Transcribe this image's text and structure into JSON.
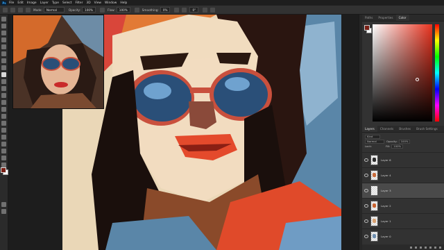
{
  "menu": {
    "logo": "Ps",
    "items": [
      "File",
      "Edit",
      "Image",
      "Layer",
      "Type",
      "Select",
      "Filter",
      "3D",
      "View",
      "Window",
      "Help"
    ]
  },
  "options": {
    "mode_label": "Mode:",
    "mode_value": "Normal",
    "opacity_label": "Opacity:",
    "opacity_value": "100%",
    "flow_label": "Flow:",
    "flow_value": "100%",
    "smoothing_label": "Smoothing:",
    "smoothing_value": "0%",
    "angle_value": "0°"
  },
  "color_panel": {
    "tabs": [
      "Paths",
      "Properties",
      "Color"
    ],
    "active_tab": "Color",
    "foreground": "#7a1f14",
    "background": "#ffffff"
  },
  "layers_panel": {
    "tabs": [
      "Layers",
      "Channels",
      "Brushes",
      "Brush Settings"
    ],
    "active_tab": "Layers",
    "kind_label": "Kind",
    "blend_mode": "Normal",
    "opacity_label": "Opacity:",
    "opacity_value": "100%",
    "lock_label": "Lock:",
    "fill_label": "Fill:",
    "fill_value": "100%",
    "layers": [
      {
        "name": "Layer 6",
        "selected": false,
        "thumb_color": "#2b2b2b"
      },
      {
        "name": "Layer 4",
        "selected": false,
        "thumb_color": "#c96b3a"
      },
      {
        "name": "Layer 3",
        "selected": true,
        "thumb_color": ""
      },
      {
        "name": "Layer 2",
        "selected": false,
        "thumb_color": "#c9622f"
      },
      {
        "name": "Layer 1",
        "selected": false,
        "thumb_color": "#d8a070"
      },
      {
        "name": "Layer 0",
        "selected": false,
        "thumb_color": "#6f8fb0"
      }
    ]
  }
}
